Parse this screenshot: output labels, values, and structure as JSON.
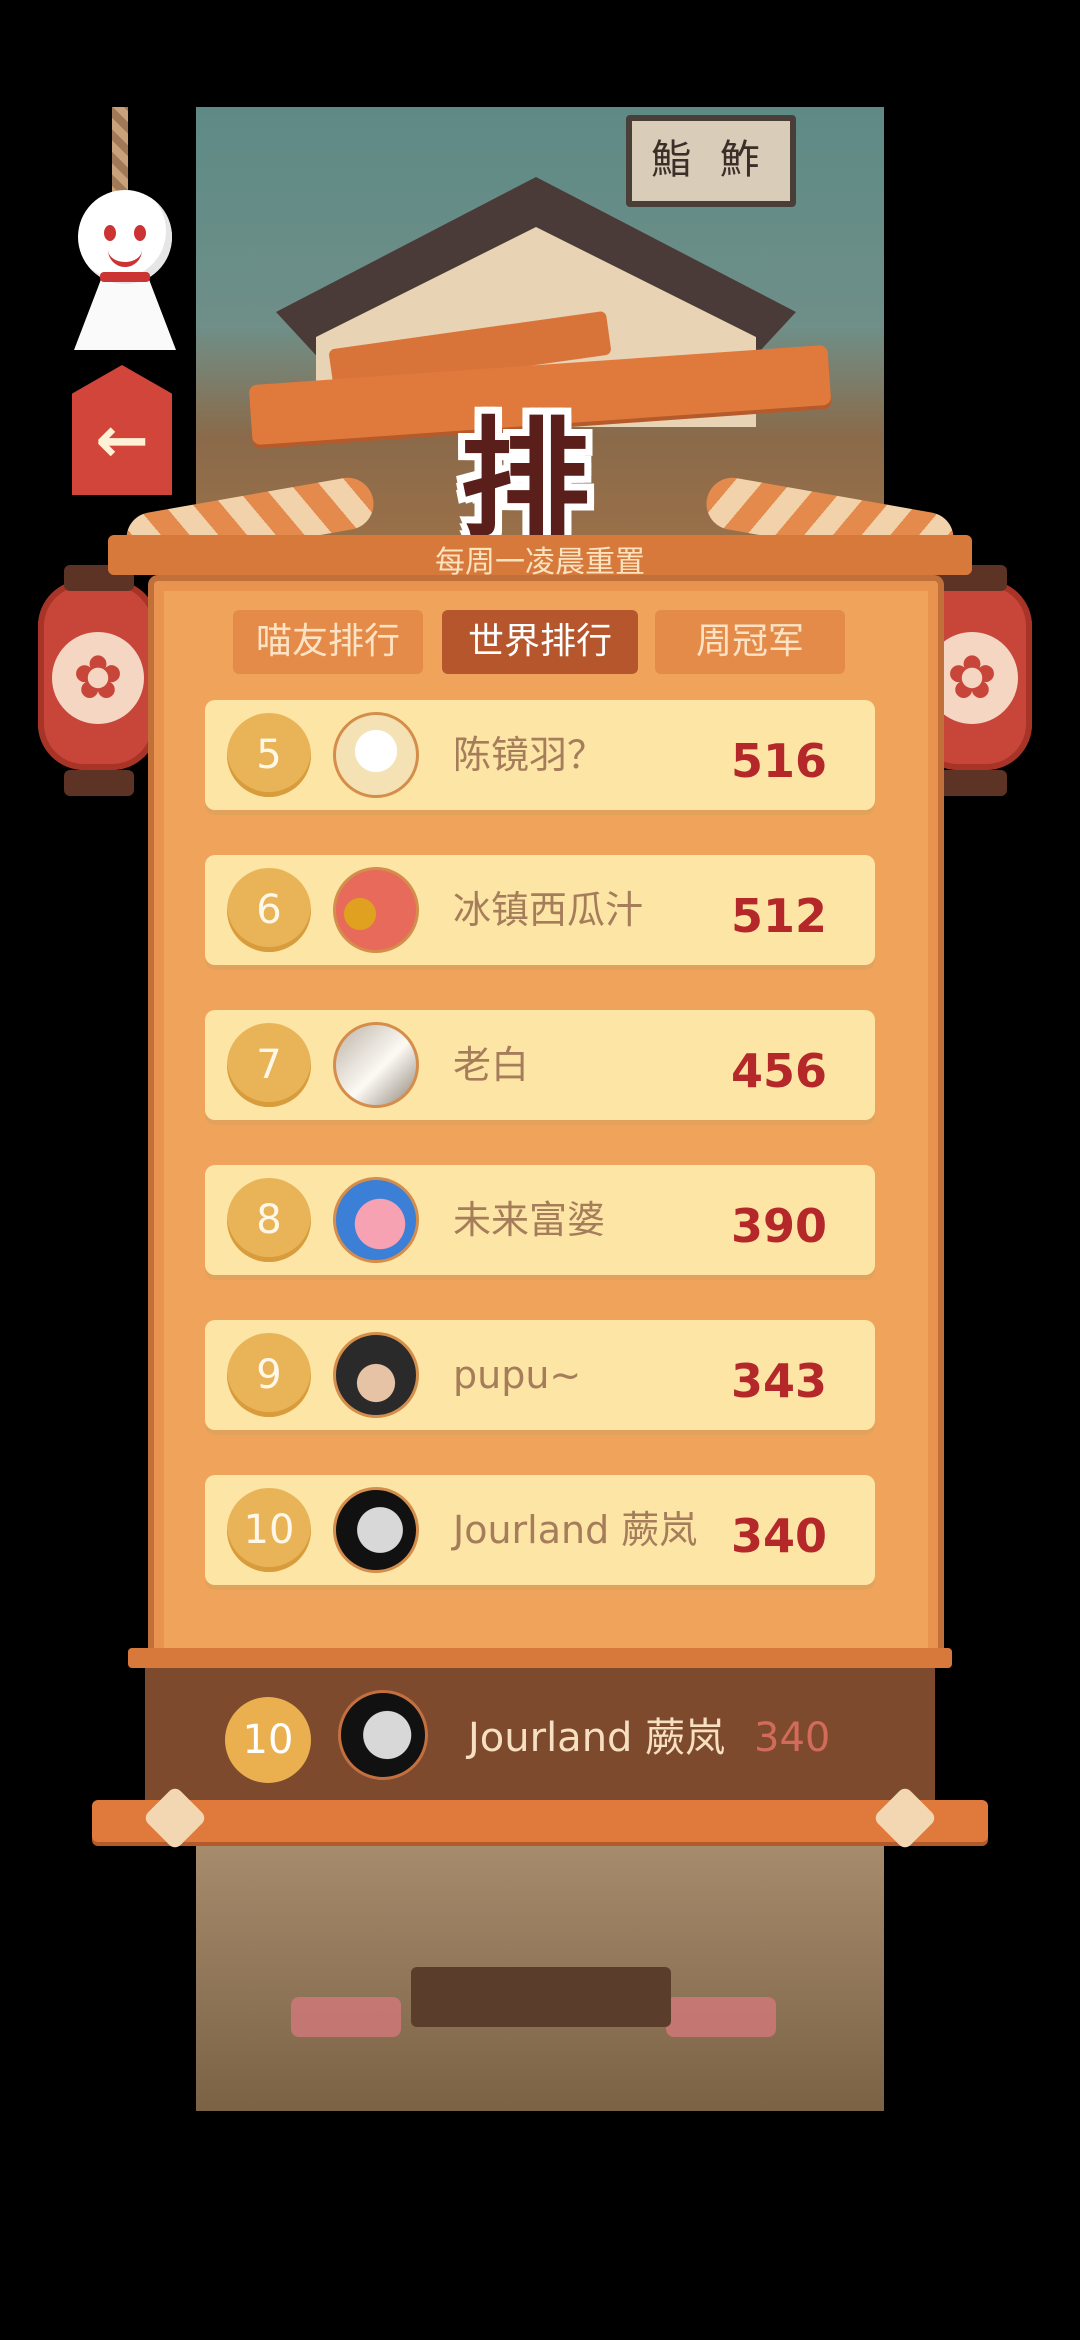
{
  "sign": {
    "text": "鮨 鮓"
  },
  "title": "排 行",
  "subtitle": "每周一凌晨重置",
  "tabs": {
    "friends": "喵友排行",
    "world": "世界排行",
    "champion": "周冠军"
  },
  "active_tab": "世界排行",
  "rows": [
    {
      "rank": "5",
      "name": "陈镜羽？",
      "score": "516"
    },
    {
      "rank": "6",
      "name": "冰镇西瓜汁",
      "score": "512"
    },
    {
      "rank": "7",
      "name": "老白",
      "score": "456"
    },
    {
      "rank": "8",
      "name": "未来富婆",
      "score": "390"
    },
    {
      "rank": "9",
      "name": "pupu~",
      "score": "343"
    },
    {
      "rank": "10",
      "name": "Jourland 蕨岚",
      "score": "340"
    }
  ],
  "self": {
    "rank": "10",
    "name": "Jourland 蕨岚",
    "score": "340"
  },
  "icons": {
    "back": "back-arrow-icon",
    "lantern": "sakura-lantern-icon",
    "doll": "teru-teru-bozu-icon"
  },
  "colors": {
    "board": "#f0a35b",
    "row": "#fde5a6",
    "score": "#b4282a",
    "active_tab": "#b5562c"
  }
}
